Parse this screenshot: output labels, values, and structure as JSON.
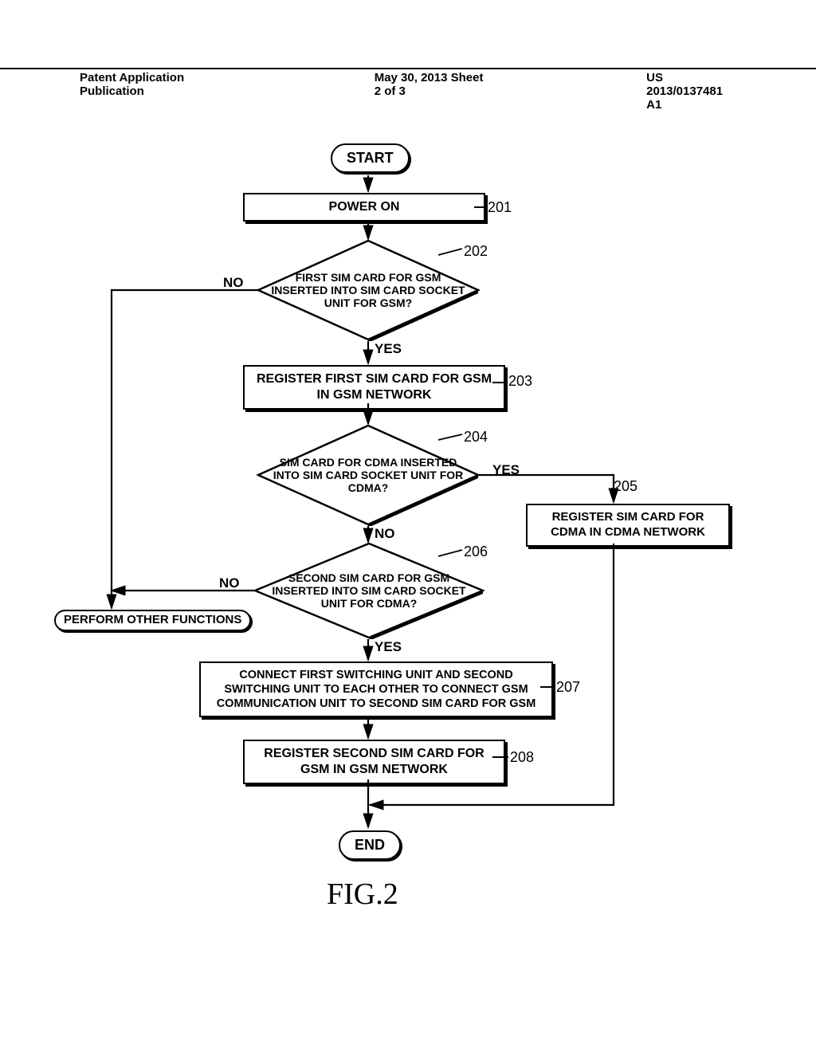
{
  "header": {
    "left": "Patent Application Publication",
    "center": "May 30, 2013  Sheet 2 of 3",
    "right": "US 2013/0137481 A1"
  },
  "nodes": {
    "start": "START",
    "power_on": "POWER ON",
    "d1": "FIRST SIM CARD FOR GSM INSERTED INTO SIM CARD SOCKET UNIT FOR GSM?",
    "reg_first": "REGISTER FIRST SIM CARD FOR GSM IN GSM NETWORK",
    "d2": "SIM CARD FOR CDMA INSERTED INTO SIM CARD SOCKET UNIT FOR CDMA?",
    "reg_cdma": "REGISTER SIM CARD FOR CDMA IN CDMA NETWORK",
    "d3": "SECOND SIM CARD FOR GSM INSERTED INTO SIM CARD SOCKET UNIT FOR CDMA?",
    "other": "PERFORM OTHER FUNCTIONS",
    "connect": "CONNECT FIRST SWITCHING UNIT AND SECOND SWITCHING UNIT TO EACH OTHER TO CONNECT GSM COMMUNICATION UNIT TO SECOND SIM CARD FOR GSM",
    "reg_second": "REGISTER SECOND SIM CARD FOR GSM IN GSM NETWORK",
    "end": "END"
  },
  "labels": {
    "yes": "YES",
    "no": "NO"
  },
  "refs": {
    "r201": "201",
    "r202": "202",
    "r203": "203",
    "r204": "204",
    "r205": "205",
    "r206": "206",
    "r207": "207",
    "r208": "208"
  },
  "figure": "FIG.2"
}
